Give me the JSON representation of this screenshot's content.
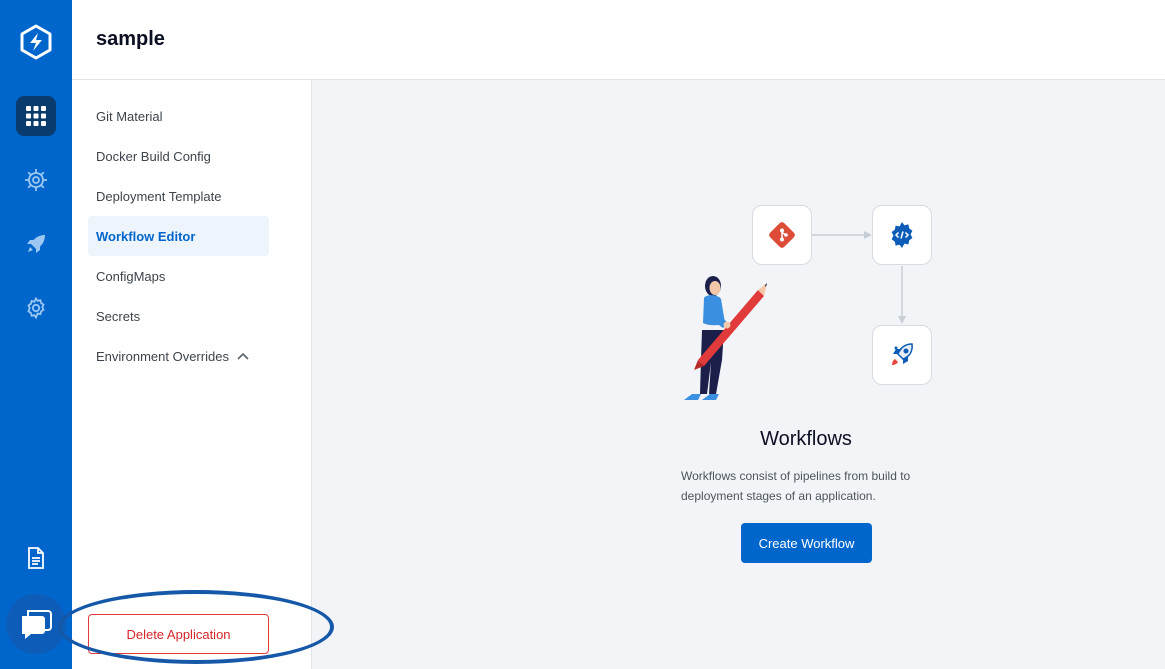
{
  "app": {
    "title": "sample"
  },
  "rail": {
    "icons": [
      "devtron-logo-icon",
      "apps-grid-icon",
      "chart-store-icon",
      "deploy-rocket-icon",
      "settings-gear-icon",
      "docs-icon",
      "chat-support-icon"
    ]
  },
  "sidebar": {
    "items": [
      {
        "label": "Git Material"
      },
      {
        "label": "Docker Build Config"
      },
      {
        "label": "Deployment Template"
      },
      {
        "label": "Workflow Editor"
      },
      {
        "label": "ConfigMaps"
      },
      {
        "label": "Secrets"
      },
      {
        "label": "Environment Overrides"
      }
    ],
    "active_index": 3,
    "delete_label": "Delete Application"
  },
  "main": {
    "title": "Workflows",
    "description": "Workflows consist of pipelines from build to deployment stages of an application.",
    "create_label": "Create Workflow"
  },
  "colors": {
    "brand": "#0066cc",
    "danger": "#d7262a",
    "git": "#dd4b39"
  }
}
